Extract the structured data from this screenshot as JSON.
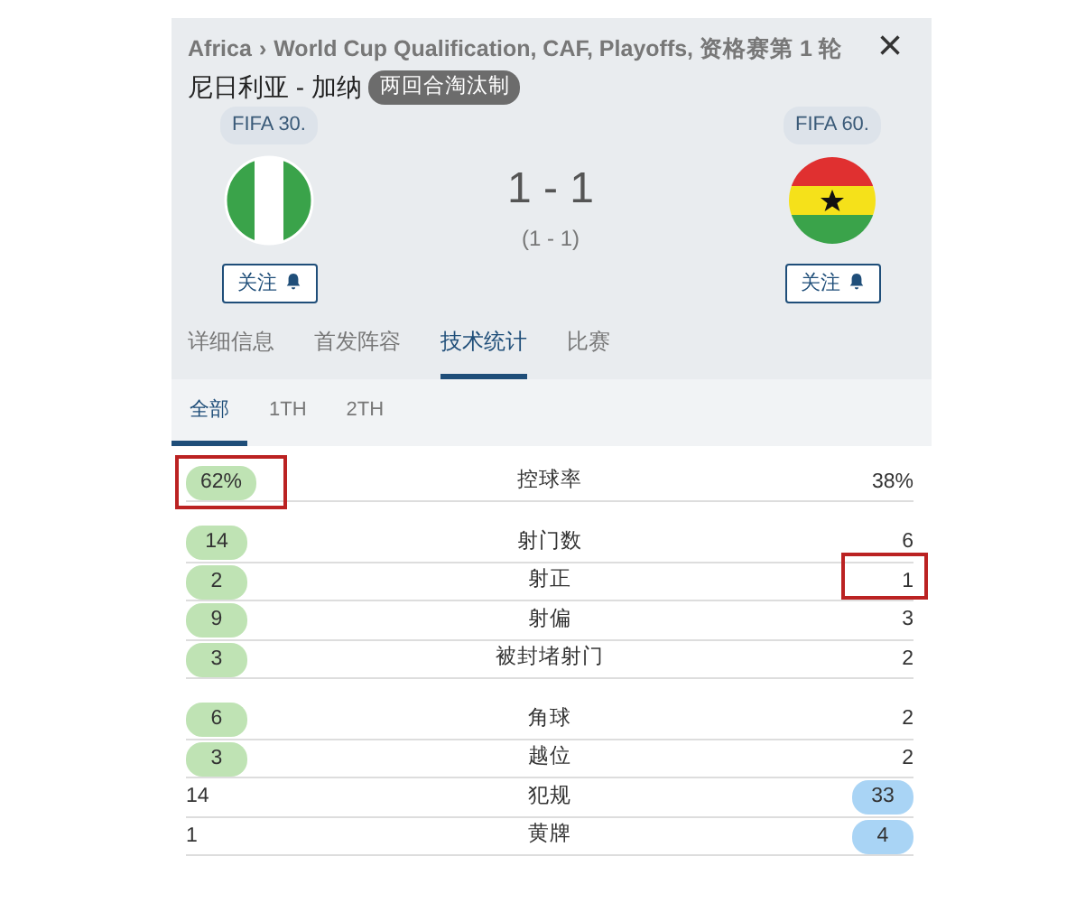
{
  "breadcrumb": {
    "region": "Africa",
    "separator": "›",
    "competition": "World Cup Qualification, CAF, Playoffs, 资格赛第 1 轮"
  },
  "close": "×",
  "match_title": "尼日利亚 - 加纳",
  "format_badge": "两回合淘汰制",
  "home": {
    "rank": "FIFA 30.",
    "kind": "nigeria",
    "follow": "关注"
  },
  "away": {
    "rank": "FIFA 60.",
    "kind": "ghana",
    "follow": "关注"
  },
  "score": "1 - 1",
  "aggregate": "(1 - 1)",
  "tabs": [
    {
      "label": "详细信息",
      "selected": false
    },
    {
      "label": "首发阵容",
      "selected": false
    },
    {
      "label": "技术统计",
      "selected": true
    },
    {
      "label": "比赛",
      "selected": false
    }
  ],
  "periods": [
    {
      "label": "全部",
      "selected": true
    },
    {
      "label": "1TH",
      "selected": false
    },
    {
      "label": "2TH",
      "selected": false
    }
  ],
  "stat_groups": [
    {
      "rows": [
        {
          "home": "62%",
          "label": "控球率",
          "away": "38%",
          "home_leads": true,
          "away_leads": false,
          "home_marked": true,
          "away_marked": false
        }
      ]
    },
    {
      "rows": [
        {
          "home": "14",
          "label": "射门数",
          "away": "6",
          "home_leads": true,
          "away_leads": false,
          "home_marked": false,
          "away_marked": false
        },
        {
          "home": "2",
          "label": "射正",
          "away": "1",
          "home_leads": true,
          "away_leads": false,
          "home_marked": false,
          "away_marked": true
        },
        {
          "home": "9",
          "label": "射偏",
          "away": "3",
          "home_leads": true,
          "away_leads": false,
          "home_marked": false,
          "away_marked": false
        },
        {
          "home": "3",
          "label": "被封堵射门",
          "away": "2",
          "home_leads": true,
          "away_leads": false,
          "home_marked": false,
          "away_marked": false
        }
      ]
    },
    {
      "rows": [
        {
          "home": "6",
          "label": "角球",
          "away": "2",
          "home_leads": true,
          "away_leads": false,
          "home_marked": false,
          "away_marked": false
        },
        {
          "home": "3",
          "label": "越位",
          "away": "2",
          "home_leads": true,
          "away_leads": false,
          "home_marked": false,
          "away_marked": false
        },
        {
          "home": "14",
          "label": "犯规",
          "away": "33",
          "home_leads": false,
          "away_leads": true,
          "home_marked": false,
          "away_marked": false
        },
        {
          "home": "1",
          "label": "黄牌",
          "away": "4",
          "home_leads": false,
          "away_leads": true,
          "home_marked": false,
          "away_marked": false
        }
      ]
    }
  ]
}
